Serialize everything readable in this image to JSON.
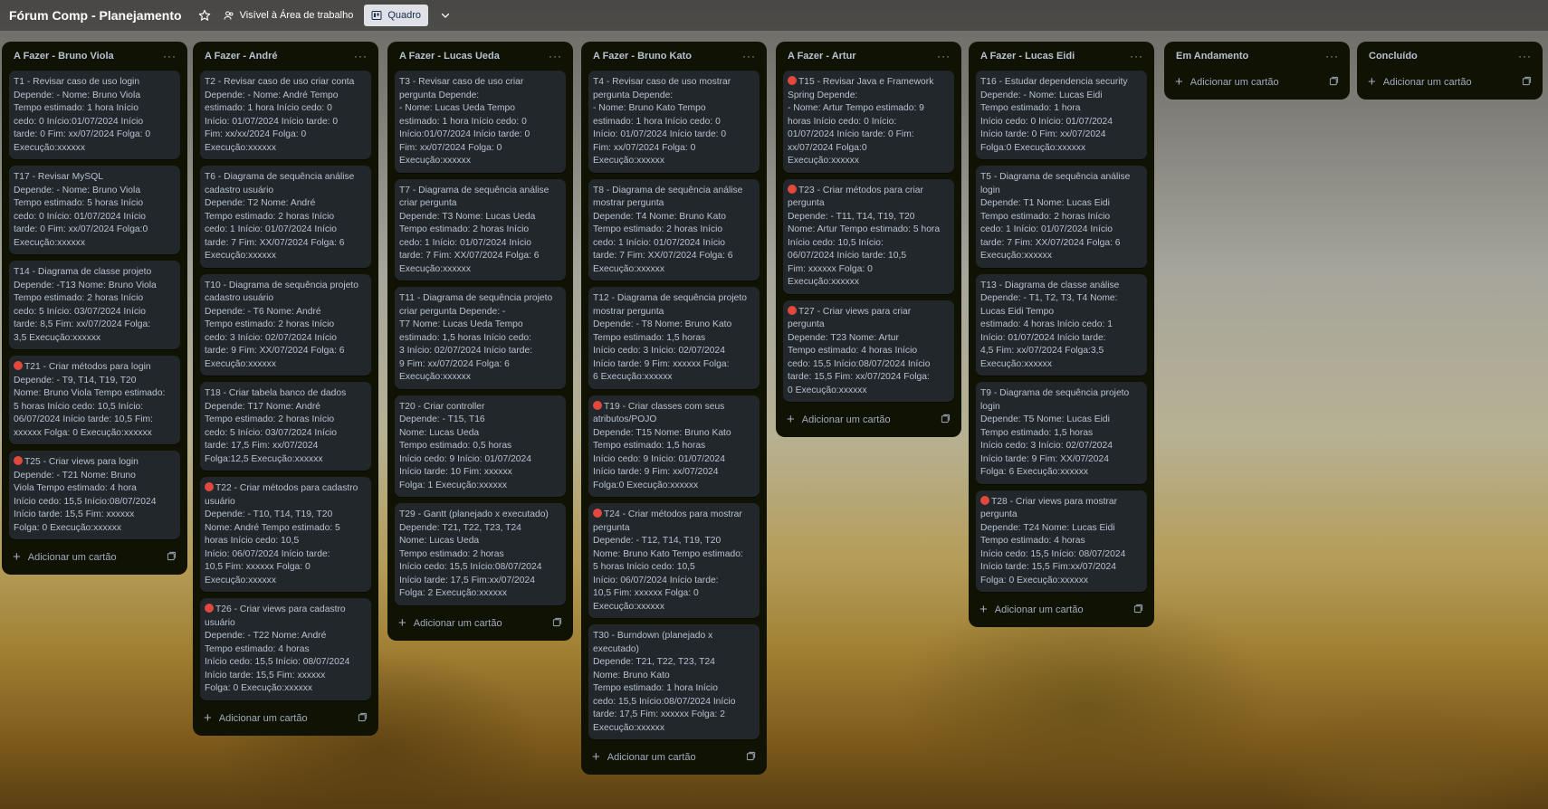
{
  "board": {
    "title": "Fórum Comp - Planejamento",
    "visibility": "Visível à Área de trabalho",
    "view": "Quadro",
    "icons": [
      "star-icon",
      "people-icon",
      "board-icon",
      "chevron-down-icon"
    ]
  },
  "add_card_label": "Adicionar um cartão",
  "lists": [
    {
      "title": "A Fazer - Bruno Viola",
      "cards": [
        {
          "label": false,
          "lines": [
            "T1 - Revisar caso de uso login",
            "Depende: -        Nome: Bruno Viola",
            "Tempo estimado: 1 hora           Início",
            "cedo: 0    Início:01/07/2024    Início",
            "tarde: 0    Fim: xx/07/2024    Folga: 0",
            "  Execução:xxxxxx"
          ]
        },
        {
          "label": false,
          "lines": [
            "T17 - Revisar MySQL",
            "Depende: -        Nome: Bruno Viola",
            "Tempo estimado: 5 horas         Início",
            "cedo: 0    Início: 01/07/2024    Início",
            "tarde: 0    Fim: xx/07/2024    Folga:0",
            " Execução:xxxxxx"
          ]
        },
        {
          "label": false,
          "lines": [
            "T14 - Diagrama de classe projeto",
            "Depende: -T13     Nome: Bruno Viola",
            "Tempo estimado: 2 horas         Início",
            "cedo: 5    Início: 03/07/2024    Início",
            "tarde: 8,5    Fim: xx/07/2024    Folga:",
            "3,5    Execução:xxxxxx"
          ]
        },
        {
          "label": true,
          "lines": [
            "T21 - Criar métodos para login",
            "  Depende: -   T9, T14, T19, T20",
            "Nome: Bruno Viola Tempo estimado:",
            "5 horas          Início cedo: 10,5    Início:",
            "06/07/2024 Início tarde: 10,5     Fim:",
            "xxxxxx    Folga: 0    Execução:xxxxxx"
          ]
        },
        {
          "label": true,
          "lines": [
            "T25 - Criar views para login",
            "    Depende: -    T21    Nome: Bruno",
            "Viola Tempo estimado: 4 hora",
            "Início cedo: 15,5    Início:08/07/2024",
            "Início tarde: 15,5    Fim: xxxxxx",
            "Folga: 0    Execução:xxxxxx"
          ]
        }
      ]
    },
    {
      "title": "A Fazer - André",
      "cards": [
        {
          "label": false,
          "lines": [
            "T2 - Revisar caso de uso criar conta",
            "Depende: -        Nome: André Tempo",
            "estimado: 1 hora         Início cedo: 0",
            "    Início: 01/07/2024  Início tarde: 0",
            "  Fim: xx/xx/2024    Folga: 0",
            "Execução:xxxxxx"
          ]
        },
        {
          "label": false,
          "lines": [
            "T6 - Diagrama de sequência análise",
            "cadastro usuário",
            "Depende: T2        Nome: André",
            "Tempo estimado: 2 horas         Início",
            "cedo: 1    Início: 01/07/2024    Início",
            "tarde: 7    Fim: XX/07/2024    Folga: 6",
            "  Execução:xxxxxx"
          ]
        },
        {
          "label": false,
          "lines": [
            "T10 - Diagrama de sequência projeto",
            "cadastro usuário",
            "Depende: - T6     Nome: André",
            "Tempo estimado: 2 horas         Início",
            "cedo: 3    Início: 02/07/2024   Início",
            "tarde: 9    Fim: XX/07/2024    Folga: 6",
            "  Execução:xxxxxx"
          ]
        },
        {
          "label": false,
          "lines": [
            "T18 - Criar tabela banco de dados",
            "Depende: T17        Nome: André",
            "Tempo estimado: 2 horas         Início",
            "cedo: 5    Início: 03/07/2024   Início",
            "tarde: 17,5      Fim: xx/07/2024",
            "Folga:12,5     Execução:xxxxxx"
          ]
        },
        {
          "label": true,
          "lines": [
            "T22 - Criar métodos para cadastro",
            "usuário",
            "Depende: -   T10, T14, T19, T20",
            "Nome: André Tempo estimado: 5",
            "horas           Início cedo: 10,5",
            "Início: 06/07/2024     Início tarde:",
            "10,5     Fim: xxxxxx    Folga: 0",
            "Execução:xxxxxx"
          ]
        },
        {
          "label": true,
          "lines": [
            "T26 - Criar views para cadastro",
            "usuário",
            "Depende: -   T22     Nome: André",
            "Tempo estimado: 4 horas",
            "Início cedo: 15,5  Início: 08/07/2024",
            "Início tarde: 15,5     Fim: xxxxxx",
            "Folga: 0    Execução:xxxxxx"
          ]
        }
      ]
    },
    {
      "title": "A Fazer - Lucas Ueda",
      "cards": [
        {
          "label": false,
          "lines": [
            "T3 - Revisar caso de uso criar",
            "pergunta                          Depende:",
            "-       Nome: Lucas Ueda Tempo",
            "estimado: 1 hora          Início cedo: 0",
            "    Início:01/07/2024     Início tarde: 0",
            "  Fim: xx/07/2024    Folga: 0",
            "Execução:xxxxxx"
          ]
        },
        {
          "label": false,
          "lines": [
            "T7 - Diagrama de sequência análise",
            "criar pergunta",
            "Depende: T3        Nome: Lucas Ueda",
            "Tempo estimado: 2 horas         Início",
            "cedo: 1    Início: 01/07/2024    Início",
            "tarde: 7    Fim: XX/07/2024    Folga: 6",
            "  Execução:xxxxxx"
          ]
        },
        {
          "label": false,
          "lines": [
            "T11 - Diagrama de sequência projeto",
            "criar pergunta                  Depende: -",
            "T7    Nome: Lucas Ueda Tempo",
            "estimado: 1,5 horas         Início cedo:",
            "3     Início: 02/07/2024     Início tarde:",
            "9    Fim: xx/07/2024     Folga: 6",
            "Execução:xxxxxx"
          ]
        },
        {
          "label": false,
          "lines": [
            "T20 - Criar controller",
            "Depende: -   T15, T16",
            "Nome: Lucas Ueda",
            "Tempo estimado: 0,5 horas",
            "Início cedo: 9       Início: 01/07/2024",
            "Início tarde: 10     Fim: xxxxxx",
            "Folga: 1    Execução:xxxxxx"
          ]
        },
        {
          "label": false,
          "lines": [
            "T29 - Gantt (planejado x executado)",
            "Depende: T21, T22, T23, T24",
            "Nome: Lucas Ueda",
            "Tempo estimado: 2 horas",
            "Início cedo: 15,5      Início:08/07/2024",
            "Início tarde: 17,5      Fim:xx/07/2024",
            "Folga: 2    Execução:xxxxxx"
          ]
        }
      ]
    },
    {
      "title": "A Fazer - Bruno Kato",
      "cards": [
        {
          "label": false,
          "lines": [
            "T4 - Revisar caso de uso mostrar",
            "pergunta                          Depende:",
            "-       Nome: Bruno Kato Tempo",
            "estimado: 1 hora          Início cedo: 0",
            "    Início: 01/07/2024     Início tarde: 0",
            "  Fim: xx/07/2024    Folga: 0",
            "Execução:xxxxxx"
          ]
        },
        {
          "label": false,
          "lines": [
            "T8 - Diagrama de sequência análise",
            "mostrar pergunta",
            "Depende: T4        Nome: Bruno Kato",
            "Tempo estimado: 2 horas         Início",
            "cedo: 1    Início: 01/07/2024    Início",
            "tarde: 7    Fim: XX/07/2024    Folga: 6",
            "  Execução:xxxxxx"
          ]
        },
        {
          "label": false,
          "lines": [
            "T12 - Diagrama de sequência projeto",
            "mostrar pergunta",
            "Depende: -   T8     Nome: Bruno Kato",
            "Tempo estimado: 1,5 horas",
            "Início cedo: 3         Início: 02/07/2024",
            "Início tarde: 9     Fim: xxxxxx     Folga:",
            "6     Execução:xxxxxx"
          ]
        },
        {
          "label": true,
          "lines": [
            "T19 - Criar classes com seus",
            "atributos/POJO",
            "Depende: T15        Nome: Bruno Kato",
            "Tempo estimado: 1,5 horas",
            "Início cedo: 9        Início: 01/07/2024",
            "Início tarde: 9      Fim: xx/07/2024",
            "Folga:0     Execução:xxxxxx"
          ]
        },
        {
          "label": true,
          "lines": [
            "T24 - Criar métodos para mostrar",
            "pergunta",
            "Depende: -  T12, T14, T19, T20",
            "Nome: Bruno Kato Tempo estimado:",
            "5 horas           Início cedo: 10,5",
            "Início: 06/07/2024      Início tarde:",
            "10,5     Fim: xxxxxx     Folga: 0",
            "Execução:xxxxxx"
          ]
        },
        {
          "label": false,
          "lines": [
            "T30 - Burndown (planejado x",
            "executado)",
            "Depende: T21, T22, T23, T24",
            "Nome: Bruno Kato",
            "Tempo estimado: 1 hora           Início",
            "cedo: 15,5   Início:08/07/2024   Início",
            "tarde: 17,5     Fim: xxxxxx     Folga: 2",
            "Execução:xxxxxx"
          ]
        }
      ]
    },
    {
      "title": "A Fazer - Artur",
      "cards": [
        {
          "label": true,
          "lines": [
            "T15 - Revisar Java e Framework",
            "Spring                              Depende:",
            "-       Nome: Artur Tempo estimado: 9",
            "horas       Início cedo: 0       Início:",
            "01/07/2024 Início tarde: 0      Fim:",
            "xx/07/2024       Folga:0",
            "Execução:xxxxxx"
          ]
        },
        {
          "label": true,
          "lines": [
            "T23 - Criar métodos para criar",
            "pergunta",
            "Depende: -   T11, T14, T19, T20",
            "Nome: Artur Tempo estimado: 5 hora",
            "         Início cedo: 10,5       Início:",
            "06/07/2024      Início tarde: 10,5",
            "Fim: xxxxxx     Folga: 0",
            "Execução:xxxxxx"
          ]
        },
        {
          "label": true,
          "lines": [
            "T27 - Criar views para criar",
            "pergunta",
            "Depende: T23         Nome: Artur",
            "Tempo estimado: 4 horas          Início",
            "cedo: 15,5   Início:08/07/2024 Início",
            "tarde: 15,5     Fim: xx/07/2024   Folga:",
            "0    Execução:xxxxxx"
          ]
        }
      ]
    },
    {
      "title": "A Fazer - Lucas Eidi",
      "cards": [
        {
          "label": false,
          "lines": [
            "T16 - Estudar dependencia security",
            "Depende: -        Nome: Lucas Eidi",
            "Tempo estimado: 1 hora",
            "Início cedo: 0      Início: 01/07/2024",
            "Início tarde: 0     Fim: xx/07/2024",
            "Folga:0    Execução:xxxxxx"
          ]
        },
        {
          "label": false,
          "lines": [
            "T5 - Diagrama de sequência análise",
            "login",
            "Depende: T1        Nome: Lucas Eidi",
            "Tempo estimado: 2 horas         Início",
            "cedo: 1    Início: 01/07/2024    Início",
            "tarde: 7    Fim: XX/07/2024    Folga: 6",
            "  Execução:xxxxxx"
          ]
        },
        {
          "label": false,
          "lines": [
            "T13 - Diagrama de classe análise",
            "Depende: - T1, T2, T3, T4        Nome:",
            "Lucas Eidi                          Tempo",
            "estimado: 4 horas        Início cedo: 1",
            "    Início: 01/07/2024     Início tarde:",
            "4,5     Fim: xx/07/2024     Folga:3,5",
            "Execução:xxxxxx"
          ]
        },
        {
          "label": false,
          "lines": [
            "T9 - Diagrama de sequência projeto",
            "login",
            "Depende: T5        Nome: Lucas Eidi",
            "Tempo estimado: 1,5 horas",
            "Início cedo: 3       Início: 02/07/2024",
            "Início tarde: 9     Fim: XX/07/2024",
            "Folga: 6     Execução:xxxxxx"
          ]
        },
        {
          "label": true,
          "lines": [
            "T28 - Criar views para mostrar",
            "pergunta",
            "Depende: T24        Nome: Lucas Eidi",
            "Tempo estimado: 4 horas",
            "Início cedo: 15,5       Início: 08/07/2024",
            "Início tarde: 15,5       Fim:xx/07/2024",
            "Folga: 0     Execução:xxxxxx"
          ]
        }
      ]
    },
    {
      "title": "Em Andamento",
      "cards": []
    },
    {
      "title": "Concluído",
      "cards": []
    }
  ]
}
